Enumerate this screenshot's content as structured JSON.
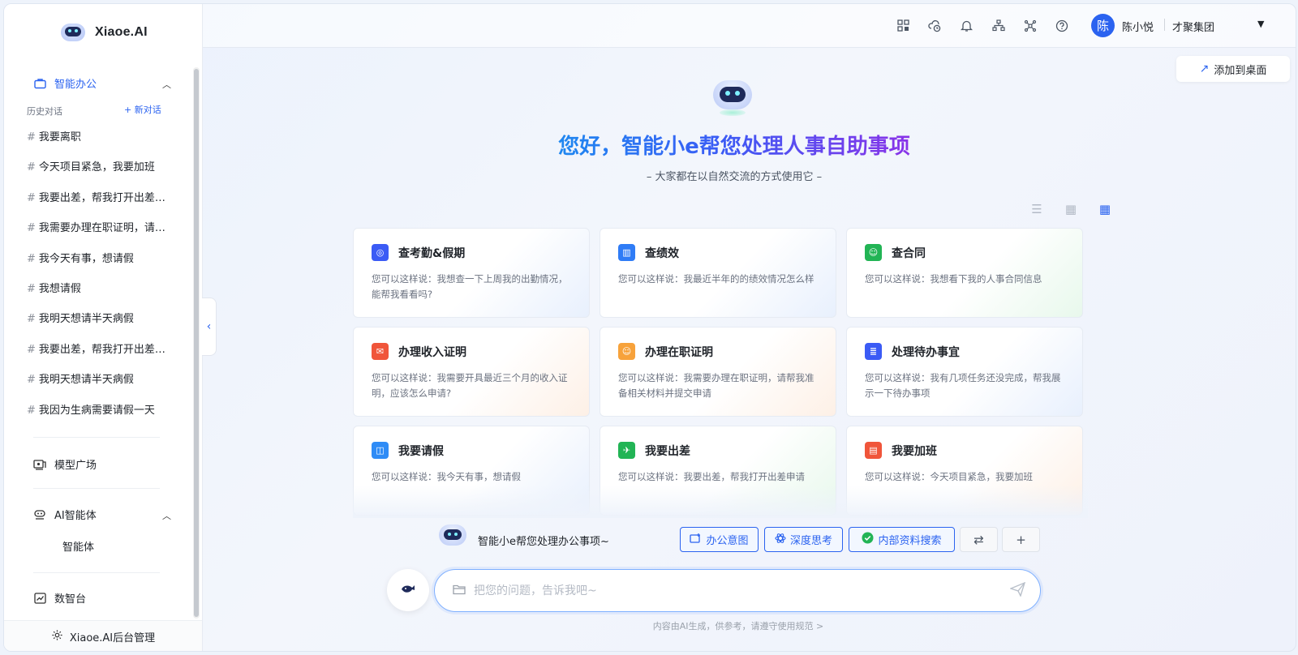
{
  "brand": {
    "name": "Xiaoe.AI"
  },
  "sidebar": {
    "office": {
      "label": "智能办公",
      "history_label": "历史对话",
      "new_chat": "+ 新对话"
    },
    "history": [
      "我要离职",
      "今天项目紧急，我要加班",
      "我要出差，帮我打开出差申请",
      "我需要办理在职证明，请帮我准备相关材料",
      "我今天有事，想请假",
      "我想请假",
      "我明天想请半天病假",
      "我要出差，帮我打开出差申请",
      "我明天想请半天病假",
      "我因为生病需要请假一天"
    ],
    "history_prefix": "#",
    "model_square": "模型广场",
    "ai_agent": "AI智能体",
    "agent_sub": "智能体",
    "data_platform": "数智台",
    "admin": "Xiaoe.AI后台管理"
  },
  "topbar": {
    "user_initial": "陈",
    "user_name": "陈小悦",
    "org": "才聚集团",
    "add_desktop": "添加到桌面",
    "icons": [
      "grid-icon",
      "cloud-clock-icon",
      "bell-icon",
      "org-chart-icon",
      "network-icon",
      "help-icon"
    ]
  },
  "hero": {
    "title": "您好，智能小e帮您处理人事自助事项",
    "subtitle": "– 大家都在以自然交流的方式使用它 –"
  },
  "cards": [
    {
      "title": "查考勤&假期",
      "desc": "您可以这样说：我想查一下上周我的出勤情况，能帮我看看吗?",
      "color": "#3b5bf5"
    },
    {
      "title": "查绩效",
      "desc": "您可以这样说：我最近半年的的绩效情况怎么样",
      "color": "#2f7cf6"
    },
    {
      "title": "查合同",
      "desc": "您可以这样说：我想看下我的人事合同信息",
      "color": "#22b455"
    },
    {
      "title": "办理收入证明",
      "desc": "您可以这样说：我需要开具最近三个月的收入证明，应该怎么申请?",
      "color": "#f0553a"
    },
    {
      "title": "办理在职证明",
      "desc": "您可以这样说：我需要办理在职证明，请帮我准备相关材料并提交申请",
      "color": "#f7a23b"
    },
    {
      "title": "处理待办事宜",
      "desc": "您可以这样说：我有几项任务还没完成，帮我展示一下待办事项",
      "color": "#3b5bf5"
    },
    {
      "title": "我要请假",
      "desc": "您可以这样说：我今天有事，想请假",
      "color": "#2f8cf6"
    },
    {
      "title": "我要出差",
      "desc": "您可以这样说：我要出差，帮我打开出差申请",
      "color": "#22b455"
    },
    {
      "title": "我要加班",
      "desc": "您可以这样说：今天项目紧急，我要加班",
      "color": "#f0553a"
    }
  ],
  "assistant": {
    "text": "智能小e帮您处理办公事项~",
    "chips": [
      "办公意图",
      "深度思考",
      "内部资料搜索"
    ]
  },
  "input": {
    "placeholder": "把您的问题，告诉我吧~"
  },
  "footer": {
    "disclaimer": "内容由AI生成，供参考，请遵守使用规范 >"
  }
}
